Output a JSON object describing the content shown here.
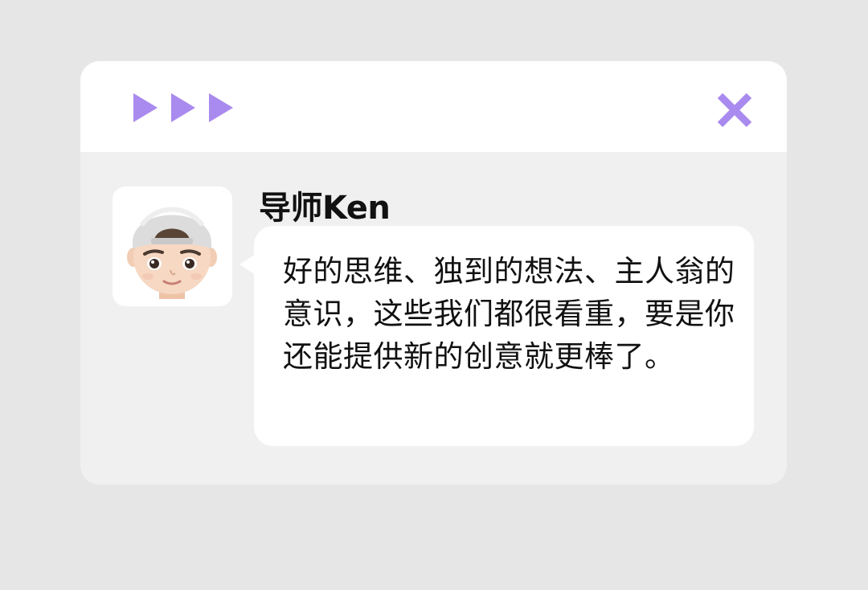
{
  "window": {
    "arrows_icon": "play-triple-icon",
    "close_icon": "close-x-icon",
    "accent_color": "#a98aee"
  },
  "chat": {
    "sender_name": "导师Ken",
    "avatar": "memoji-avatar",
    "message": "好的思维、独到的想法、主人翁的意识，这些我们都很看重，要是你还能提供新的创意就更棒了。"
  }
}
